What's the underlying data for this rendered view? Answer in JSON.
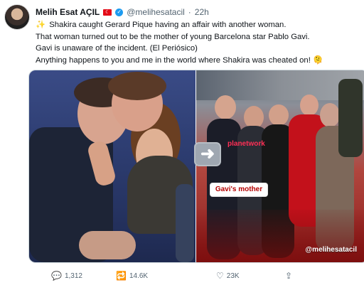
{
  "tweet": {
    "author_name": "Melih Esat AÇIL",
    "country_flag": "🇹🇷",
    "verified": true,
    "handle": "@melihesatacil",
    "separator": "·",
    "time": "22h",
    "lines": [
      "Shakira caught Gerard Pique having an affair with another woman.",
      "That woman turned out to be the mother of young Barcelona star Pablo Gavi.",
      "Gavi is unaware of the incident. (El Periósico)",
      "Anything happens to you and me in the world where Shakira was cheated on! 🫠"
    ],
    "spark_icon": "✨",
    "media": {
      "caption": "Gavi's mother",
      "watermark": "@melihesatacil",
      "logo_text": "planetwork"
    },
    "actions": {
      "replies": "1,312",
      "retweets": "14.6K",
      "likes": "23K"
    },
    "icons": {
      "reply": "reply-icon",
      "retweet": "retweet-icon",
      "like": "heart-icon",
      "share": "share-icon"
    }
  }
}
